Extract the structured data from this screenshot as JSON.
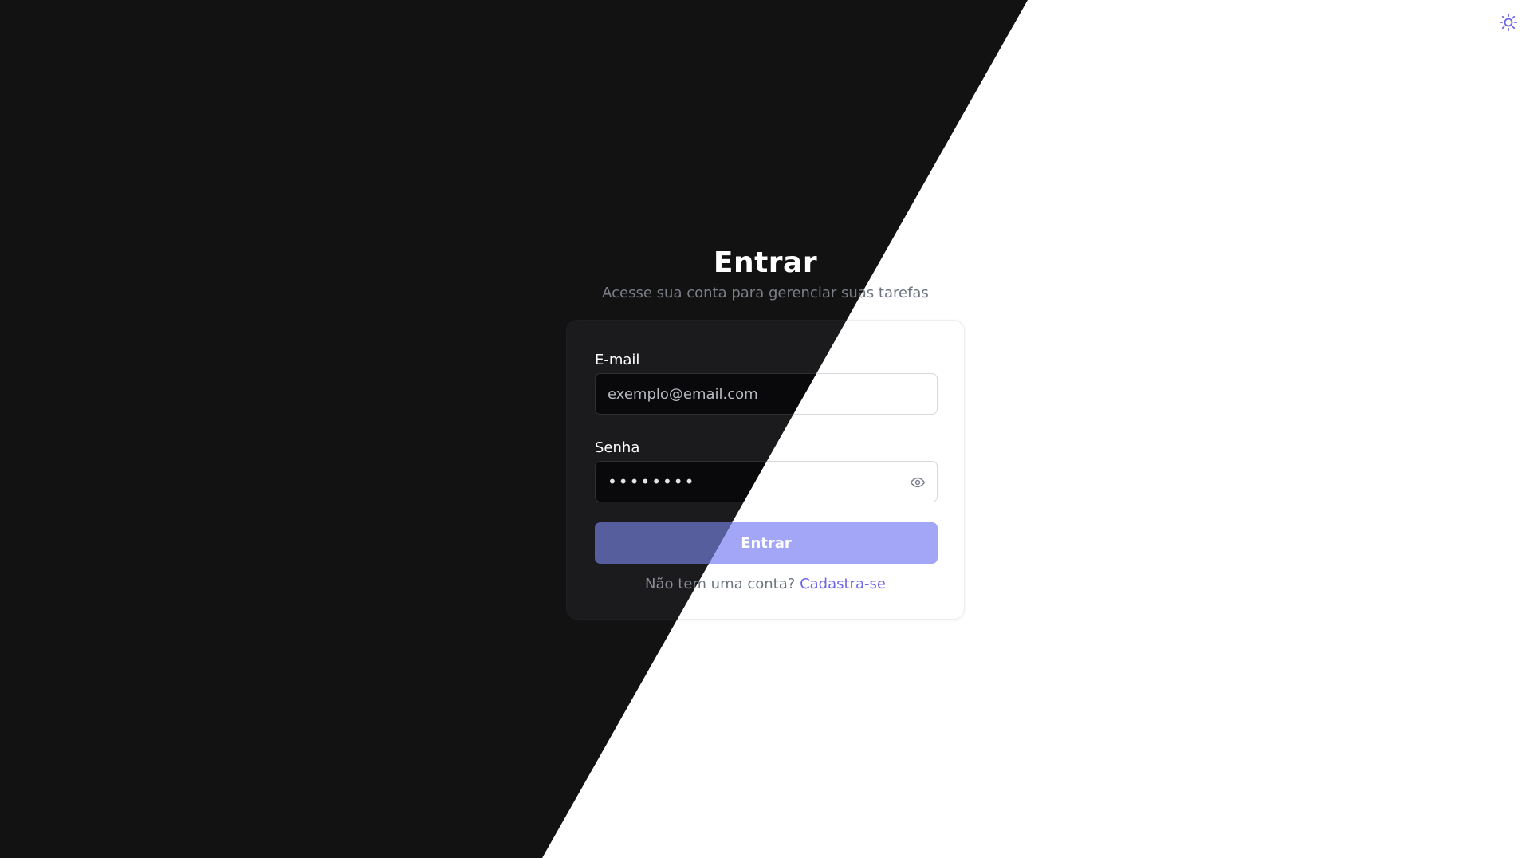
{
  "header": {
    "title": "Entrar",
    "subtitle": "Acesse sua conta para gerenciar suas tarefas"
  },
  "form": {
    "email_label": "E-mail",
    "email_placeholder": "exemplo@email.com",
    "password_label": "Senha",
    "password_value": "••••••••",
    "submit_label": "Entrar"
  },
  "signup": {
    "prompt": "Não tem uma conta?",
    "link": "Cadastra-se"
  },
  "icons": {
    "theme_toggle": "sun-icon",
    "password_toggle": "eye-icon"
  },
  "colors": {
    "accent": "#6e66e4",
    "button": "#a3a6f6",
    "dark_background": "#121213"
  }
}
